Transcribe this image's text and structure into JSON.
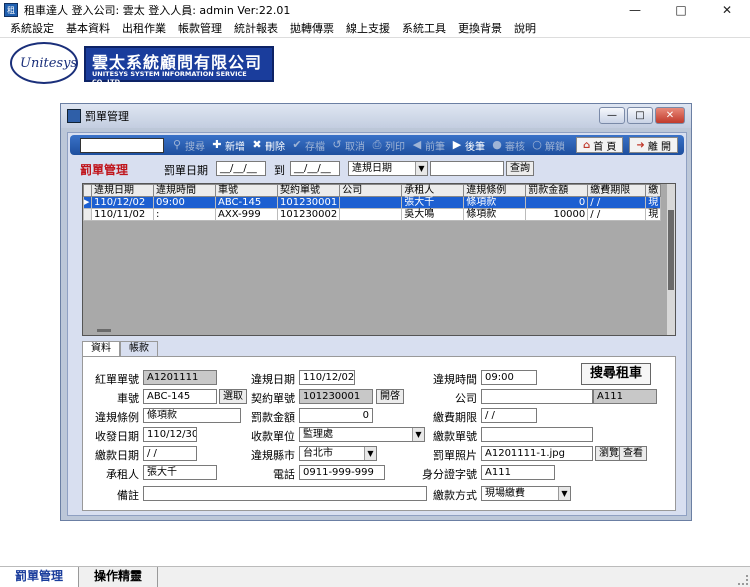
{
  "app": {
    "title": "租車達人  登入公司: 雲太  登入人員: admin Ver:22.01",
    "icon_glyph": "租"
  },
  "menu": [
    "系統設定",
    "基本資料",
    "出租作業",
    "帳款管理",
    "統計報表",
    "拋轉傳票",
    "線上支援",
    "系統工具",
    "更換背景",
    "說明"
  ],
  "logo": {
    "oval_text": "Unitesys",
    "company_cn": "雲太系統顧問有限公司",
    "company_en": "UNITESYS SYSTEM INFORMATION SERVICE CO.,LTD."
  },
  "window": {
    "title": "罰單管理"
  },
  "toolbar": {
    "search_value": "",
    "search": "搜尋",
    "add": "新增",
    "delete": "刪除",
    "save": "存檔",
    "cancel": "取消",
    "print": "列印",
    "prev": "前筆",
    "next": "後筆",
    "audit": "審核",
    "unlock": "解鎖",
    "home": "首 頁",
    "exit": "離 開"
  },
  "filter": {
    "section_title": "罰單管理",
    "date_label": "罰單日期",
    "date_from": "__/__/__",
    "to_label": "到",
    "date_to": "__/__/__",
    "date_type": "違規日期",
    "keyword": "",
    "query_button": "查詢"
  },
  "grid": {
    "columns": [
      "違規日期",
      "違規時間",
      "車號",
      "契約單號",
      "公司",
      "承租人",
      "違規條例",
      "罰款金額",
      "繳費期限",
      "繳"
    ],
    "rows": [
      {
        "indicator": "▶",
        "cells": [
          "110/12/02",
          "09:00",
          "ABC-145",
          "101230001",
          "",
          "張大千",
          "條項款",
          "0",
          " / /",
          "現"
        ]
      },
      {
        "indicator": "",
        "cells": [
          "110/11/02",
          " :",
          "AXX-999",
          "101230002",
          "",
          "吳大鳴",
          "條項款",
          "10000",
          " / /",
          "現"
        ]
      }
    ]
  },
  "tabs": [
    "資料",
    "帳款"
  ],
  "form": {
    "ticket_no_label": "紅單單號",
    "ticket_no": "A1201111",
    "violation_date_label": "違規日期",
    "violation_date": "110/12/02",
    "violation_time_label": "違規時間",
    "violation_time": "09:00",
    "search_car": "搜尋租車",
    "plate_label": "車號",
    "plate": "ABC-145",
    "pick_button": "選取",
    "contract_label": "契約單號",
    "contract": "101230001",
    "open_button": "開啓",
    "company_label": "公司",
    "company": "",
    "company_code": "A111",
    "rule_label": "違規條例",
    "rule": "條項款",
    "fine_label": "罰款金額",
    "fine": "0",
    "due_label": "繳費期限",
    "due": " / /",
    "received_label": "收發日期",
    "received": "110/12/30",
    "unit_label": "收款單位",
    "unit": "監理處",
    "pay_no_label": "繳款單號",
    "pay_no": "",
    "pay_date_label": "繳款日期",
    "pay_date": " / /",
    "city_label": "違規縣市",
    "city": "台北市",
    "photo_label": "罰單照片",
    "photo": "A1201111-1.jpg",
    "browse_button": "瀏覽",
    "view_button": "查看",
    "renter_label": "承租人",
    "renter": "張大千",
    "phone_label": "電話",
    "phone": "0911-999-999",
    "id_label": "身分證字號",
    "id": "A111",
    "note_label": "備註",
    "note": "",
    "method_label": "繳款方式",
    "method": "現場繳費"
  },
  "bottom_tabs": [
    "罰單管理",
    "操作精靈"
  ]
}
